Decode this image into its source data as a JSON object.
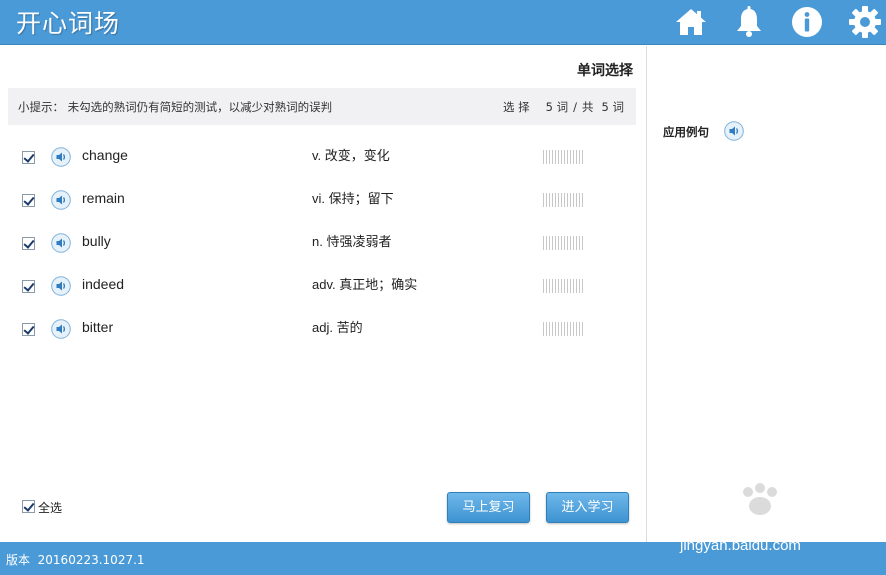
{
  "app": {
    "title": "开心词场"
  },
  "header_icons": [
    "home-icon",
    "bell-icon",
    "info-icon",
    "gear-icon"
  ],
  "main": {
    "section_title": "单词选择",
    "tip": "小提示：  未勾选的熟词仍有简短的测试，以减少对熟词的误判",
    "count": {
      "select_label": "选 择",
      "selected": "5 词",
      "separator": "/",
      "total_label": "共",
      "total": "5 词"
    },
    "words": [
      {
        "word": "change",
        "definition": "v. 改变，变化",
        "checked": true
      },
      {
        "word": "remain",
        "definition": "vi. 保持；留下",
        "checked": true
      },
      {
        "word": "bully",
        "definition": "n. 恃强凌弱者",
        "checked": true
      },
      {
        "word": "indeed",
        "definition": "adv. 真正地；确实",
        "checked": true
      },
      {
        "word": "bitter",
        "definition": "adj. 苦的",
        "checked": true
      }
    ],
    "select_all_label": "全选",
    "buttons": {
      "review": "马上复习",
      "learn": "进入学习"
    }
  },
  "side": {
    "label": "应用例句"
  },
  "footer": {
    "version_label": "版本",
    "version": "20160223.1027.1"
  },
  "watermark": {
    "text": "jingyan.baidu.com"
  },
  "colors": {
    "header_bg": "#4a9ad8",
    "button_bg": "#4aa0dc"
  }
}
